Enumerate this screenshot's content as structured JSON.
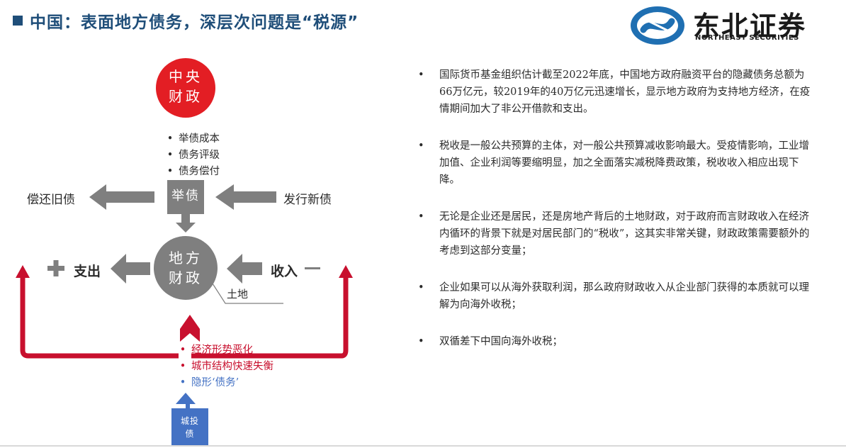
{
  "header": {
    "title": "中国：表面地方债务，深层次问题是“税源”"
  },
  "logo": {
    "name_cn": "东北证券",
    "name_en": "NORTHEAST SECURITIES"
  },
  "diagram": {
    "central_finance": "中央\n财政",
    "borrowing_factors": [
      "举债成本",
      "债务评级",
      "债务偿付"
    ],
    "borrowing": "举债",
    "repay_old_debt": "偿还旧债",
    "issue_new_debt": "发行新债",
    "local_finance": "地方\n财政",
    "expenditure": "支出",
    "income": "收入",
    "land": "土地",
    "risk_factors": [
      "经济形势恶化",
      "城市结构快速失衡"
    ],
    "hidden_debt": "隐形‘债务’",
    "urban_bond": "城投\n债",
    "colors": {
      "red": "#e31e24",
      "gray": "#7f7f7f",
      "dark_red": "#c8102e",
      "blue": "#4472c4"
    }
  },
  "points": [
    "国际货币基金组织估计截至2022年底，中国地方政府融资平台的隐藏债务总额为66万亿元，较2019年的40万亿元迅速增长，显示地方政府为支持地方经济，在疫情期间加大了非公开借款和支出。",
    "税收是一般公共预算的主体，对一般公共预算减收影响最大。受疫情影响，工业增加值、企业利润等要缩明显，加之全面落实减税降费政策，税收收入相应出现下降。",
    "无论是企业还是居民，还是房地产背后的土地财政，对于政府而言财政收入在经济内循环的背景下就是对居民部门的“税收”，这其实非常关键，财政政策需要额外的考虑到这部分变量；",
    "企业如果可以从海外获取利润，那么政府财政收入从企业部门获得的本质就可以理解为向海外收税；",
    "双循差下中国向海外收税；"
  ]
}
